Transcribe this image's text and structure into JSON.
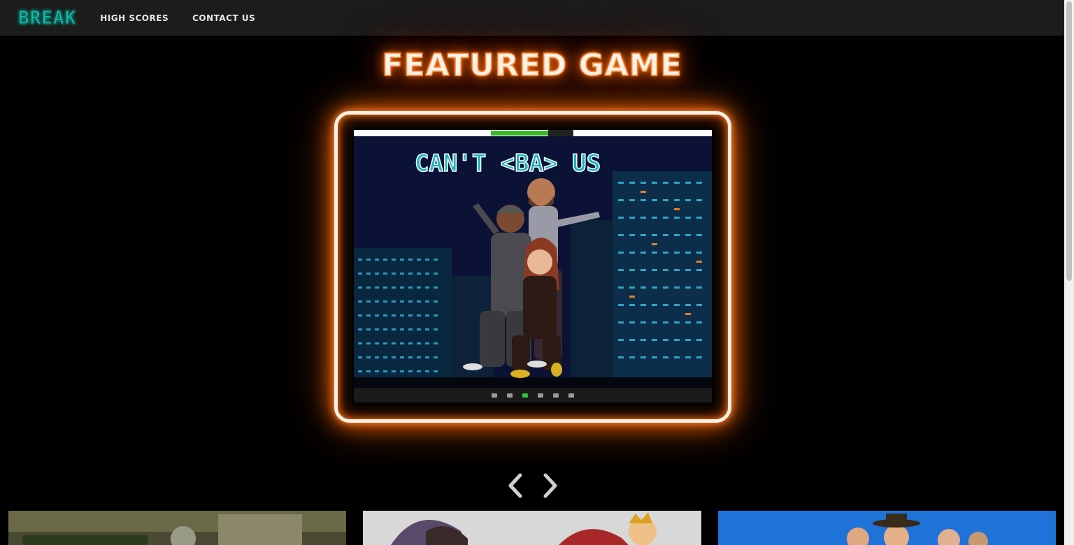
{
  "nav": {
    "logo": "BREAK",
    "links": [
      "HIGH SCORES",
      "CONTACT US"
    ]
  },
  "featured": {
    "heading": "FEATURED GAME",
    "game_title": "CAN'T <BA> US"
  },
  "carousel": {
    "prev_icon": "chevron-left-icon",
    "next_icon": "chevron-right-icon"
  },
  "cards": [
    "game-card-1",
    "game-card-2",
    "game-card-3"
  ],
  "colors": {
    "brand_teal": "#14b8a6",
    "neon_orange": "#ff6a00",
    "nav_bg": "#1c1c1c"
  }
}
